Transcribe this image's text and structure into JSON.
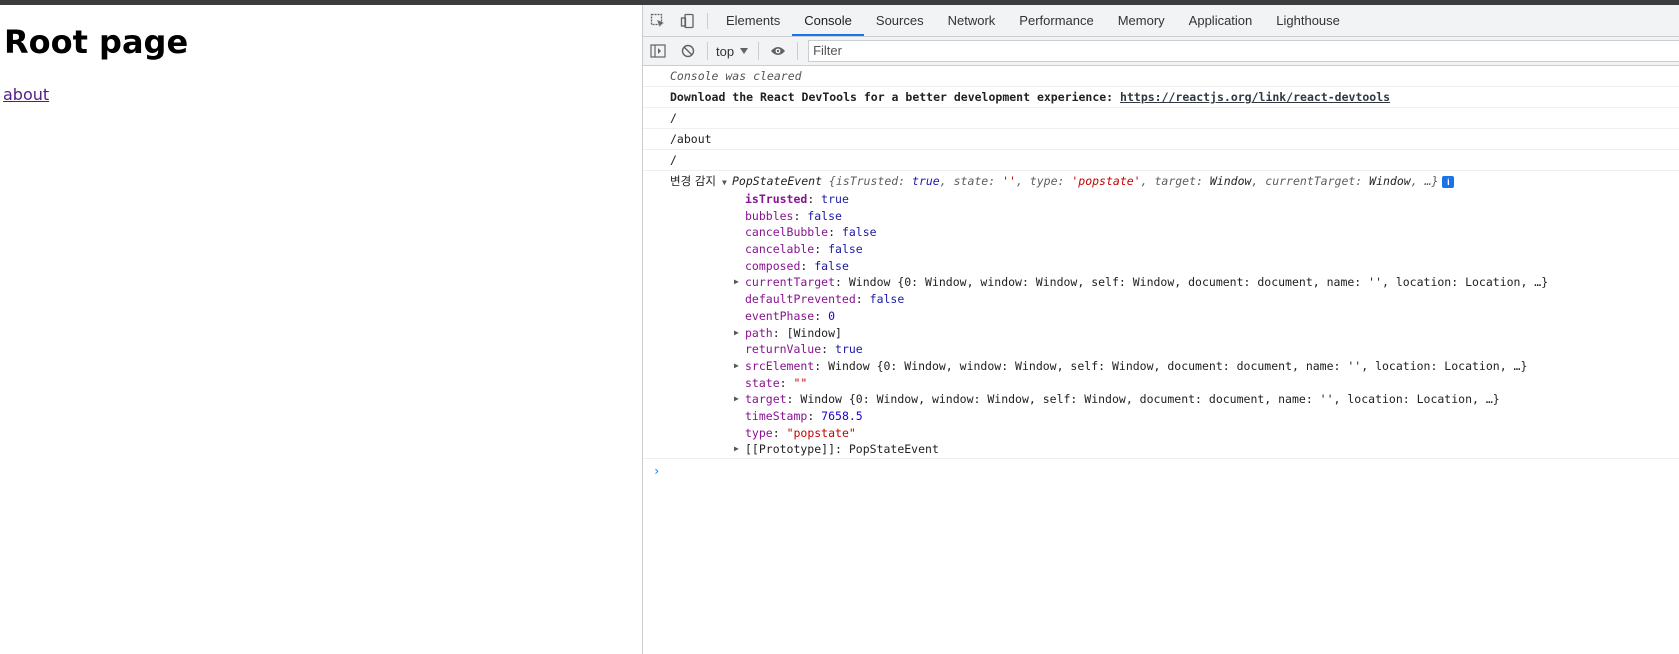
{
  "page": {
    "heading": "Root page",
    "link": "about"
  },
  "devtools": {
    "tabs": [
      "Elements",
      "Console",
      "Sources",
      "Network",
      "Performance",
      "Memory",
      "Application",
      "Lighthouse"
    ],
    "active_tab": "Console",
    "toolbar": {
      "context": "top",
      "filter_placeholder": "Filter"
    },
    "console": {
      "cleared": "Console was cleared",
      "react_msg": "Download the React DevTools for a better development experience: ",
      "react_link": "https://reactjs.org/link/react-devtools",
      "log1": "/",
      "log2": "/about",
      "log3": "/",
      "event_prefix": "변경 감지",
      "event_summary": {
        "name": "PopStateEvent",
        "open": " {",
        "isTrusted_k": "isTrusted",
        "isTrusted_v": "true",
        "state_k": "state",
        "state_v": "''",
        "type_k": "type",
        "type_v": "'popstate'",
        "target_k": "target",
        "target_v": "Window",
        "currentTarget_k": "currentTarget",
        "currentTarget_v": "Window",
        "close": "…}",
        "info": "i"
      },
      "props": [
        {
          "key": "isTrusted",
          "value": "true",
          "kind": "bool",
          "bold": true
        },
        {
          "key": "bubbles",
          "value": "false",
          "kind": "bool"
        },
        {
          "key": "cancelBubble",
          "value": "false",
          "kind": "bool"
        },
        {
          "key": "cancelable",
          "value": "false",
          "kind": "bool"
        },
        {
          "key": "composed",
          "value": "false",
          "kind": "bool"
        },
        {
          "key": "currentTarget",
          "value": "Window {0: Window, window: Window, self: Window, document: document, name: '', location: Location, …}",
          "kind": "obj",
          "expandable": true
        },
        {
          "key": "defaultPrevented",
          "value": "false",
          "kind": "bool"
        },
        {
          "key": "eventPhase",
          "value": "0",
          "kind": "num"
        },
        {
          "key": "path",
          "value": "[Window]",
          "kind": "obj",
          "expandable": true
        },
        {
          "key": "returnValue",
          "value": "true",
          "kind": "bool"
        },
        {
          "key": "srcElement",
          "value": "Window {0: Window, window: Window, self: Window, document: document, name: '', location: Location, …}",
          "kind": "obj",
          "expandable": true
        },
        {
          "key": "state",
          "value": "\"\"",
          "kind": "str"
        },
        {
          "key": "target",
          "value": "Window {0: Window, window: Window, self: Window, document: document, name: '', location: Location, …}",
          "kind": "obj",
          "expandable": true
        },
        {
          "key": "timeStamp",
          "value": "7658.5",
          "kind": "num"
        },
        {
          "key": "type",
          "value": "\"popstate\"",
          "kind": "str"
        },
        {
          "key": "[[Prototype]]",
          "value": "PopStateEvent",
          "kind": "proto",
          "expandable": true
        }
      ],
      "prompt": "›"
    }
  },
  "icons": [
    "inspect-element-icon",
    "device-toolbar-icon",
    "sidebar-toggle-icon",
    "clear-console-icon",
    "eye-icon",
    "dropdown-arrow-icon"
  ],
  "colors": {
    "accent": "#1a73e8",
    "key": "#881391",
    "string": "#c80000",
    "number": "#1c00cf"
  }
}
